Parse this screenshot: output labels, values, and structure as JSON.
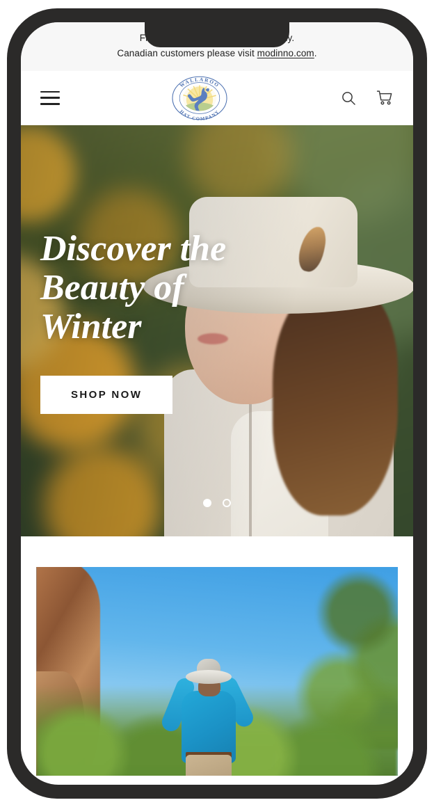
{
  "announcement": {
    "line1": "Free Shipping on                          ontinental US only.",
    "line2_prefix": "Canadian customers please visit ",
    "link_text": "modinno.com",
    "line2_suffix": "."
  },
  "header": {
    "menu_icon": "hamburger-menu-icon",
    "logo": {
      "top_text": "WALLAROO",
      "bottom_text": "HAT COMPANY",
      "mark": "kangaroo-sunrise-emblem",
      "border_color": "#4a6fb0",
      "sun_color": "#f5e08a",
      "hill_color": "#b9ce8e",
      "kangaroo_color": "#5b7fc0"
    },
    "search_icon": "search-icon",
    "cart_icon": "shopping-cart-icon"
  },
  "hero": {
    "title": "Discover the\nBeauty of\nWinter",
    "cta_label": "Shop Now",
    "slide_count": 2,
    "active_slide": 1,
    "image_alt": "woman-in-cream-wide-brim-hat-autumn-background"
  },
  "promo": {
    "image_alt": "man-in-blue-shirt-and-sun-hat-hiking-in-canyon"
  },
  "colors": {
    "announce_bg": "#f7f7f7",
    "header_bg": "#ffffff",
    "text": "#1f1f1f",
    "device_frame": "#2b2a29",
    "cta_bg": "#ffffff",
    "cta_text": "#1a1a1a"
  }
}
